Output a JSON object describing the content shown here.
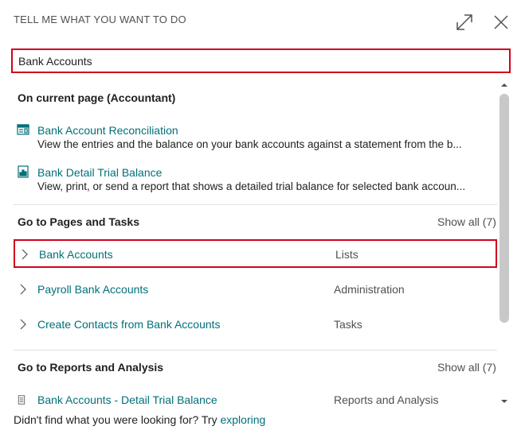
{
  "header": {
    "title": "TELL ME WHAT YOU WANT TO DO"
  },
  "search": {
    "value": "Bank Accounts"
  },
  "current_page": {
    "heading": "On current page (Accountant)",
    "items": [
      {
        "icon": "worksheet-icon",
        "title": "Bank Account Reconciliation",
        "description": "View the entries and the balance on your bank accounts against a statement from the b..."
      },
      {
        "icon": "report-icon",
        "title": "Bank Detail Trial Balance",
        "description": "View, print, or send a report that shows a detailed trial balance for selected bank accoun..."
      }
    ]
  },
  "pages_tasks": {
    "heading": "Go to Pages and Tasks",
    "show_all": "Show all (7)",
    "rows": [
      {
        "title": "Bank Accounts",
        "category": "Lists"
      },
      {
        "title": "Payroll Bank Accounts",
        "category": "Administration"
      },
      {
        "title": "Create Contacts from Bank Accounts",
        "category": "Tasks"
      }
    ]
  },
  "reports": {
    "heading": "Go to Reports and Analysis",
    "show_all": "Show all (7)",
    "rows": [
      {
        "icon": "report-icon",
        "title": "Bank Accounts - Detail Trial Balance",
        "category": "Reports and Analysis"
      }
    ]
  },
  "footer": {
    "text": "Didn't find what you were looking for? Try ",
    "link": "exploring"
  },
  "colors": {
    "link": "#00707a",
    "highlight_border": "#d0021b",
    "muted_text": "#505050"
  }
}
